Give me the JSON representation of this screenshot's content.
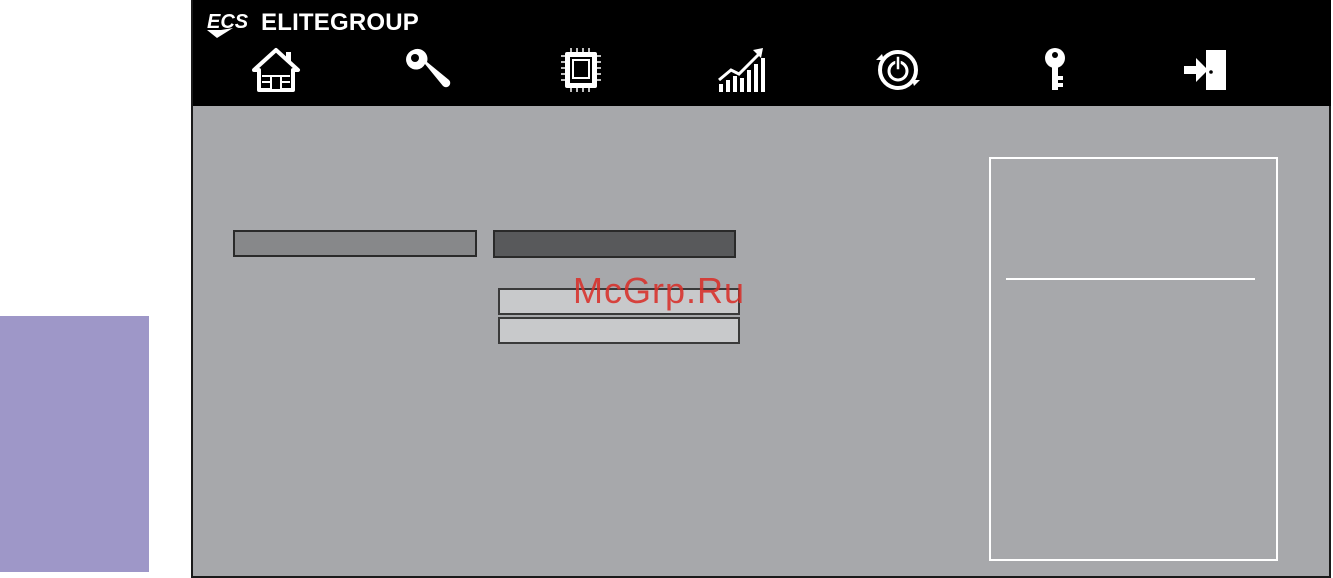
{
  "brand": {
    "logo_text": "ECS",
    "name": "ELITEGROUP"
  },
  "nav": {
    "items": [
      {
        "id": "main",
        "icon": "home-icon"
      },
      {
        "id": "advanced",
        "icon": "wrench-icon"
      },
      {
        "id": "chipset",
        "icon": "chip-icon"
      },
      {
        "id": "performance",
        "icon": "performance-chart-icon"
      },
      {
        "id": "boot",
        "icon": "power-icon"
      },
      {
        "id": "security",
        "icon": "key-icon"
      },
      {
        "id": "exit",
        "icon": "exit-icon"
      }
    ]
  },
  "watermark": {
    "text": "McGrp.Ru"
  },
  "colors": {
    "topbar": "#000000",
    "body": "#a7a8ab",
    "side_tab": "#9e97c8",
    "label_box": "#87888a",
    "value_box": "#58595b",
    "dropdown_option": "#c8c9cb",
    "watermark": "#d9302a"
  }
}
